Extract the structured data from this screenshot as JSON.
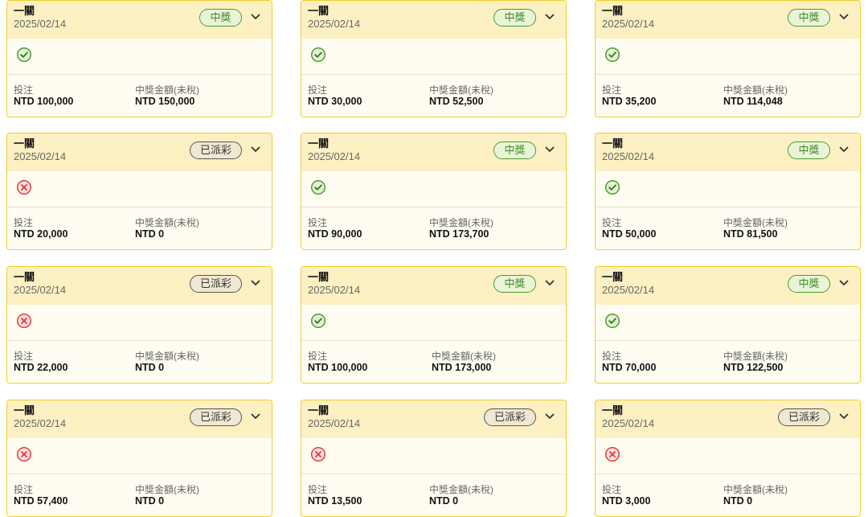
{
  "labels": {
    "stake": "投注",
    "payout": "中獎金額(未稅)"
  },
  "icons": {
    "expand": "chevron-down-icon",
    "win": "check-circle-icon",
    "lose": "cross-circle-icon"
  },
  "colors": {
    "card_border": "#f2cc2c",
    "card_header": "#fdf0c3",
    "card_body": "#fffdf1",
    "win_green": "#4e9a34",
    "lose_red": "#e03a3a"
  },
  "bets": [
    {
      "title": "一關",
      "date": "2025/02/14",
      "badge": "中獎",
      "status": "win",
      "stake": "NTD 100,000",
      "payout": "NTD 150,000"
    },
    {
      "title": "一關",
      "date": "2025/02/14",
      "badge": "中獎",
      "status": "win",
      "stake": "NTD 30,000",
      "payout": "NTD 52,500"
    },
    {
      "title": "一關",
      "date": "2025/02/14",
      "badge": "中獎",
      "status": "win",
      "stake": "NTD 35,200",
      "payout": "NTD 114,048"
    },
    {
      "title": "一關",
      "date": "2025/02/14",
      "badge": "已派彩",
      "status": "lose",
      "stake": "NTD 20,000",
      "payout": "NTD 0"
    },
    {
      "title": "一關",
      "date": "2025/02/14",
      "badge": "中獎",
      "status": "win",
      "stake": "NTD 90,000",
      "payout": "NTD 173,700"
    },
    {
      "title": "一關",
      "date": "2025/02/14",
      "badge": "中獎",
      "status": "win",
      "stake": "NTD 50,000",
      "payout": "NTD 81,500"
    },
    {
      "title": "一關",
      "date": "2025/02/14",
      "badge": "已派彩",
      "status": "lose",
      "stake": "NTD 22,000",
      "payout": "NTD 0"
    },
    {
      "title": "一關",
      "date": "2025/02/14",
      "badge": "中獎",
      "status": "win",
      "stake": "NTD 100,000",
      "payout": "NTD 173,000"
    },
    {
      "title": "一關",
      "date": "2025/02/14",
      "badge": "中獎",
      "status": "win",
      "stake": "NTD 70,000",
      "payout": "NTD 122,500"
    },
    {
      "title": "一關",
      "date": "2025/02/14",
      "badge": "已派彩",
      "status": "lose",
      "stake": "NTD 57,400",
      "payout": "NTD 0"
    },
    {
      "title": "一關",
      "date": "2025/02/14",
      "badge": "已派彩",
      "status": "lose",
      "stake": "NTD 13,500",
      "payout": "NTD 0"
    },
    {
      "title": "一關",
      "date": "2025/02/14",
      "badge": "已派彩",
      "status": "lose",
      "stake": "NTD 3,000",
      "payout": "NTD 0"
    }
  ]
}
